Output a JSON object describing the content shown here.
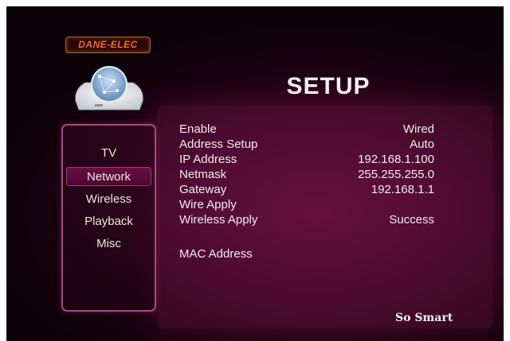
{
  "brand": {
    "logo_text": "DANE-ELEC",
    "slogan": "So Smart"
  },
  "header": {
    "title": "SETUP"
  },
  "menu": {
    "items": [
      {
        "label": "TV"
      },
      {
        "label": "Network",
        "selected": true
      },
      {
        "label": "Wireless"
      },
      {
        "label": "Playback"
      },
      {
        "label": "Misc"
      }
    ]
  },
  "network": {
    "rows": [
      {
        "label": "Enable",
        "value": "Wired"
      },
      {
        "label": "Address Setup",
        "value": "Auto"
      },
      {
        "label": "IP Address",
        "value": "192.168.1.100"
      },
      {
        "label": "Netmask",
        "value": "255.255.255.0"
      },
      {
        "label": "Gateway",
        "value": "192.168.1.1"
      },
      {
        "label": "Wire Apply",
        "value": ""
      },
      {
        "label": "Wireless Apply",
        "value": "Success"
      },
      {
        "label": "MAC Address",
        "value": ""
      }
    ]
  },
  "colors": {
    "accent": "#a84a7c",
    "background": "#3a0524",
    "logo": "#ff6a2a"
  },
  "icons": {
    "device": "network-router-icon"
  }
}
